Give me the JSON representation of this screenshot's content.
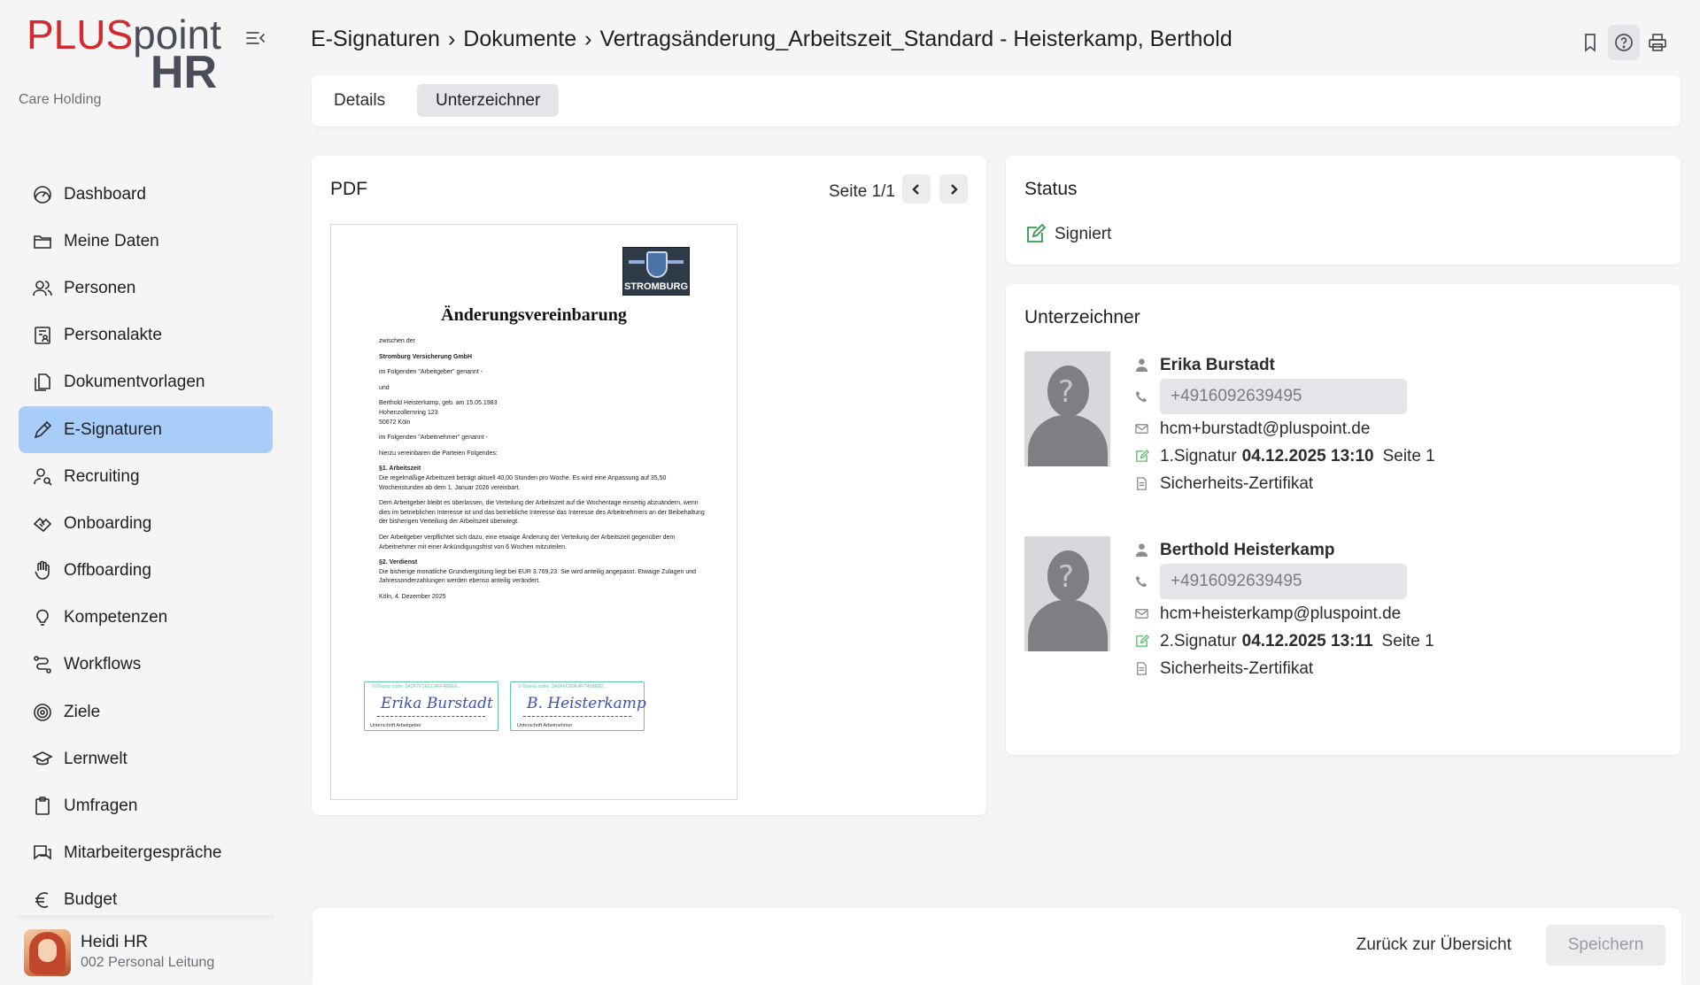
{
  "app": {
    "logo_plus": "PLUS",
    "logo_point": "point",
    "logo_hr": "HR",
    "org_name": "Care Holding"
  },
  "sidebar": {
    "items": [
      {
        "label": "Dashboard",
        "icon": "dashboard-icon"
      },
      {
        "label": "Meine Daten",
        "icon": "folder-icon"
      },
      {
        "label": "Personen",
        "icon": "people-icon"
      },
      {
        "label": "Personalakte",
        "icon": "file-person-icon"
      },
      {
        "label": "Dokumentvorlagen",
        "icon": "documents-icon"
      },
      {
        "label": "E-Signaturen",
        "icon": "pen-icon",
        "active": true
      },
      {
        "label": "Recruiting",
        "icon": "search-person-icon"
      },
      {
        "label": "Onboarding",
        "icon": "handshake-icon"
      },
      {
        "label": "Offboarding",
        "icon": "hand-icon"
      },
      {
        "label": "Kompetenzen",
        "icon": "lightbulb-icon"
      },
      {
        "label": "Workflows",
        "icon": "workflow-icon"
      },
      {
        "label": "Ziele",
        "icon": "target-icon"
      },
      {
        "label": "Lernwelt",
        "icon": "graduation-cap-icon"
      },
      {
        "label": "Umfragen",
        "icon": "clipboard-icon"
      },
      {
        "label": "Mitarbeitergespräche",
        "icon": "chat-icon"
      },
      {
        "label": "Budget",
        "icon": "euro-icon"
      }
    ]
  },
  "user": {
    "name": "Heidi HR",
    "role": "002 Personal Leitung"
  },
  "header": {
    "breadcrumb": [
      "E-Signaturen",
      "Dokumente",
      "Vertragsänderung_Arbeitszeit_Standard - Heisterkamp, Berthold"
    ],
    "separator": "›"
  },
  "tabs": [
    {
      "label": "Details",
      "active": false
    },
    {
      "label": "Unterzeichner",
      "active": true
    }
  ],
  "pdf": {
    "title": "PDF",
    "page_info": "Seite 1/1",
    "document": {
      "logo_text": "STROMBURG",
      "heading": "Änderungsvereinbarung",
      "lines": [
        "zwischen der",
        "Stromburg Versicherung GmbH",
        "im Folgenden \"Arbeitgeber\" genannt -",
        "und",
        "Berthold Heisterkamp, geb. am 15.05.1983",
        "Hohenzollernring 123",
        "50672 Köln",
        "im Folgenden \"Arbeitnehmer\" genannt -",
        "hierzu vereinbaren die Parteien Folgendes:",
        "§1. Arbeitszeit",
        "Die regelmäßige Arbeitszeit beträgt aktuell 40,00 Stunden pro Woche. Es wird eine Anpassung auf 35,50 Wochenstunden ab dem 1. Januar 2026 vereinbart.",
        "Dem Arbeitgeber bleibt es überlassen, die Verteilung der Arbeitszeit auf die Wochentage einseitig abzuändern, wenn dies im betrieblichen Interesse ist und das betriebliche Interesse das Interesse des Arbeitnehmers an der Beibehaltung der bisherigen Verteilung der Arbeitszeit überwiegt.",
        "Der Arbeitgeber verpflichtet sich dazu, eine etwaige Änderung der Verteilung der Arbeitszeit gegenüber dem Arbeitnehmer mit einer Ankündigungsfrist von 6 Wochen mitzuteilen.",
        "§2. Verdienst",
        "Die bisherige monatliche Grundvergütung liegt bei EUR 3.769,23. Sie wird anteilig angepasst. Etwaige Zulagen und Jahressonderzahlungen werden ebenso anteilig verändert.",
        "Köln, 4. Dezember 2025"
      ],
      "sig1_code": "V-Dopez code: 342F7F1E1C4FF48EEE...",
      "sig1_name": "Erika Burstadt",
      "sig1_under": "Unterschrift Arbeitgeber",
      "sig2_code": "V-Dopez code: 3A6F6C69EAF7458E82...",
      "sig2_name": "B. Heisterkamp",
      "sig2_under": "Unterschrift Arbeitnehmer"
    }
  },
  "status": {
    "title": "Status",
    "value": "Signiert",
    "color": "#2e9e4e"
  },
  "signers": {
    "title": "Unterzeichner",
    "list": [
      {
        "name": "Erika Burstadt",
        "phone": "+4916092639495",
        "email": "hcm+burstadt@pluspoint.de",
        "signature_label": "1.Signatur",
        "signature_date": "04.12.2025 13:10",
        "signature_page": "Seite 1",
        "certificate": "Sicherheits-Zertifikat"
      },
      {
        "name": "Berthold Heisterkamp",
        "phone": "+4916092639495",
        "email": "hcm+heisterkamp@pluspoint.de",
        "signature_label": "2.Signatur",
        "signature_date": "04.12.2025 13:11",
        "signature_page": "Seite 1",
        "certificate": "Sicherheits-Zertifikat"
      }
    ]
  },
  "footer": {
    "back_label": "Zurück zur Übersicht",
    "save_label": "Speichern"
  },
  "colors": {
    "brand_red": "#d42a2e",
    "brand_gray": "#4a4e59",
    "active_nav": "#a9cdf9",
    "signature_green": "#5ec7a3"
  }
}
